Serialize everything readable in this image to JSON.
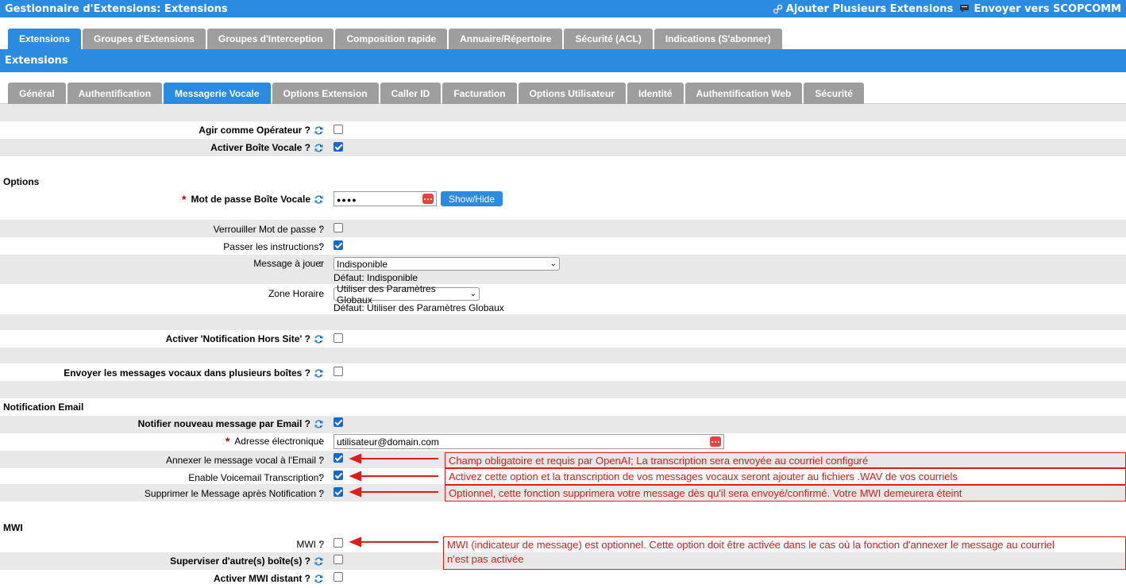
{
  "header": {
    "title": "Gestionnaire d'Extensions:  Extensions",
    "add_multiple": "Ajouter Plusieurs Extensions",
    "send_to": "Envoyer vers SCOPCOMM"
  },
  "main_tabs": [
    {
      "label": "Extensions",
      "active": true
    },
    {
      "label": "Groupes d'Extensions"
    },
    {
      "label": "Groupes d'Interception"
    },
    {
      "label": "Composition rapide"
    },
    {
      "label": "Annuaire/Répertoire"
    },
    {
      "label": "Sécurité (ACL)"
    },
    {
      "label": "Indications (S'abonner)"
    }
  ],
  "section_title": "Extensions",
  "sub_tabs": [
    {
      "label": "Général"
    },
    {
      "label": "Authentification"
    },
    {
      "label": "Messagerie Vocale",
      "active": true
    },
    {
      "label": "Options Extension"
    },
    {
      "label": "Caller ID"
    },
    {
      "label": "Facturation"
    },
    {
      "label": "Options Utilisateur"
    },
    {
      "label": "Identité"
    },
    {
      "label": "Authentification Web"
    },
    {
      "label": "Sécurité"
    }
  ],
  "form": {
    "operator_label": "Agir comme Opérateur ?",
    "operator_checked": false,
    "voicemail_label": "Activer Boîte Vocale ?",
    "voicemail_checked": true,
    "options_title": "Options",
    "password_label": "Mot de passe Boîte Vocale",
    "password_value": "●●●●",
    "show_hide": "Show/Hide",
    "lock_password_label": "Verrouiller Mot de passe ?",
    "lock_password_checked": false,
    "skip_instructions_label": "Passer les instructions?",
    "skip_instructions_checked": true,
    "message_label": "Message à jouer",
    "message_value": "Indisponible",
    "message_default": "Défaut: Indisponible",
    "timezone_label": "Zone Horaire",
    "timezone_value": "Utiliser des Paramètres Globaux",
    "timezone_default": "Défaut: Utiliser des Paramètres Globaux",
    "offsite_label": "Activer 'Notification Hors Site' ?",
    "offsite_checked": false,
    "multi_box_label": "Envoyer les messages vocaux dans plusieurs boîtes ?",
    "multi_box_checked": false,
    "email_title": "Notification Email",
    "notify_email_label": "Notifier nouveau message par Email ?",
    "notify_email_checked": true,
    "email_label": "Adresse électronique",
    "email_value": "utilisateur@domain.com",
    "attach_label": "Annexer le message vocal à l'Email ?",
    "attach_checked": true,
    "transcription_label": "Enable Voicemail Transcription?",
    "transcription_checked": true,
    "delete_label": "Supprimer le Message après Notification ?",
    "delete_checked": true,
    "mwi_title": "MWI",
    "mwi_label": "MWI ?",
    "mwi_checked": false,
    "supervise_label": "Superviser d'autre(s) boîte(s) ?",
    "supervise_checked": false,
    "remote_mwi_label": "Activer MWI distant ?",
    "remote_mwi_checked": false
  },
  "annotations": {
    "attach_note": "Champ obligatoire et requis par OpenAI; La transcription sera envoyée au courriel configuré",
    "transcription_note": "Activez cette option et la transcription de vos messages vocaux seront ajouter au fichiers .WAV de vos courriels",
    "delete_note": "Optionnel, cette fonction supprimera votre message dès qu'il sera envoyé/confirmé. Votre MWI demeurera éteint",
    "mwi_note_line1": "MWI (indicateur de message) est optionnel. Cette option doit être activée dans le cas où la fonction d'annexer le message au courriel",
    "mwi_note_line2": "n'est pas activée"
  },
  "colors": {
    "primary_blue": "#2b8be0",
    "tab_gray": "#9e9e9e",
    "row_gray": "#e8e8e8",
    "annotation_red": "#e01b1b"
  }
}
